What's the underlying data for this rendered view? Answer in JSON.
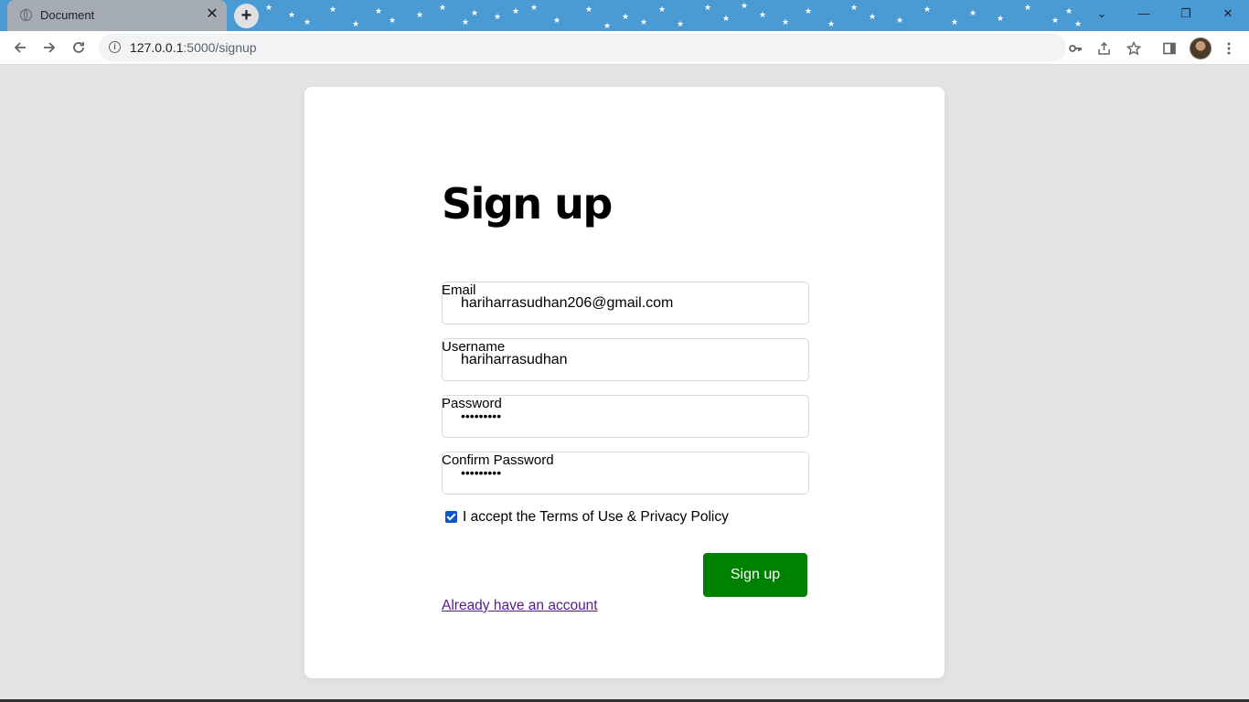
{
  "browser": {
    "tab_title": "Document",
    "tab_close": "✕",
    "new_tab": "+",
    "url_host": "127.0.0.1",
    "url_path": ":5000/signup",
    "window_controls": {
      "tab_search": "⌄",
      "minimize": "—",
      "restore": "❐",
      "close": "✕"
    },
    "icons": {
      "back": "arrow-left-icon",
      "forward": "arrow-right-icon",
      "reload": "reload-icon",
      "site_info": "info-icon",
      "password_key": "key-icon",
      "share": "share-icon",
      "bookmark": "star-icon",
      "side_panel": "side-panel-icon",
      "menu": "kebab-menu-icon"
    },
    "colors": {
      "titlebar": "#4a9ad4",
      "tab": "#a6acb4"
    }
  },
  "signup": {
    "heading": "Sign up",
    "email_label": "Email",
    "email_value": "hariharrasudhan206@gmail.com",
    "username_label": "Username",
    "username_value": "hariharrasudhan",
    "password_label": "Password",
    "password_value": "•••••••••",
    "confirm_label": "Confirm Password",
    "confirm_value": "•••••••••",
    "terms_checked": true,
    "terms_text": "I accept the Terms of Use & Privacy Policy",
    "submit_label": "Sign up",
    "login_link": "Already have an account",
    "colors": {
      "button": "#008000",
      "link": "#551a8b",
      "page_bg": "#e5e4e2",
      "card_bg": "#ffffff"
    }
  }
}
